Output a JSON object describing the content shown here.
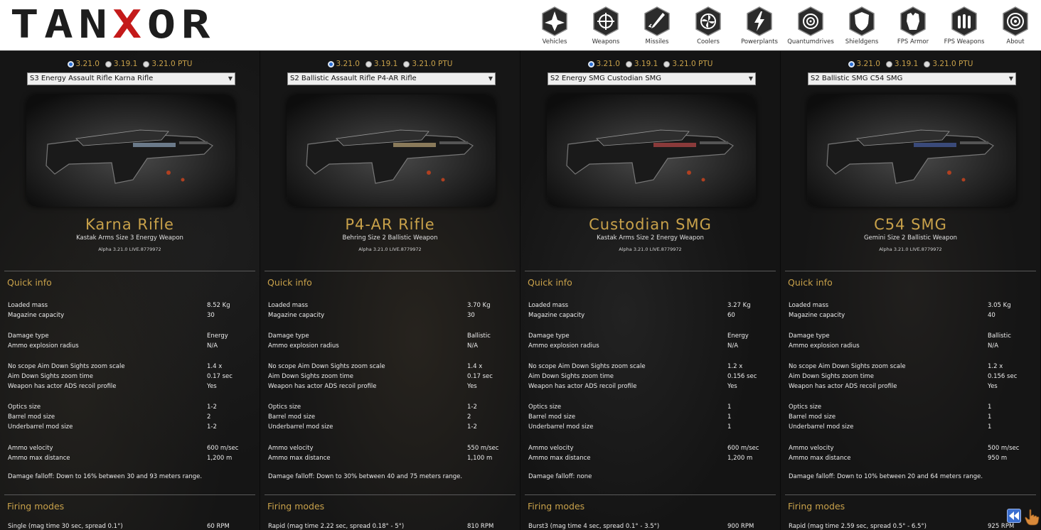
{
  "app": {
    "logo_text_a": "TAN",
    "logo_text_x": "X",
    "logo_text_b": "OR"
  },
  "nav": [
    {
      "label": "Vehicles",
      "icon": "vehicles-icon"
    },
    {
      "label": "Weapons",
      "icon": "crosshair-icon"
    },
    {
      "label": "Missiles",
      "icon": "missile-icon"
    },
    {
      "label": "Coolers",
      "icon": "fan-icon"
    },
    {
      "label": "Powerplants",
      "icon": "lightning-icon"
    },
    {
      "label": "Quantumdrives",
      "icon": "quantum-icon"
    },
    {
      "label": "Shieldgens",
      "icon": "shield-icon"
    },
    {
      "label": "FPS Armor",
      "icon": "armor-icon"
    },
    {
      "label": "FPS Weapons",
      "icon": "ammo-icon"
    },
    {
      "label": "About",
      "icon": "target-icon"
    }
  ],
  "columns": [
    {
      "versions": [
        "3.21.0",
        "3.19.1",
        "3.21.0 PTU"
      ],
      "selected_version": 0,
      "select_value": "S3 Energy Assault Rifle Karna Rifle",
      "name": "Karna Rifle",
      "subtitle": "Kastak Arms Size 3 Energy Weapon",
      "version_line": "Alpha 3.21.0 LIVE.8779972",
      "quick_info_title": "Quick info",
      "loaded_mass": "8.52 Kg",
      "magazine_capacity": "30",
      "damage_type": "Energy",
      "ammo_explosion_radius": "N/A",
      "no_scope_zoom": "1.4 x",
      "ads_zoom_time": "0.17 sec",
      "ads_recoil": "Yes",
      "optics_size": "1-2",
      "barrel_mod_size": "2",
      "underbarrel_mod_size": "1-2",
      "ammo_velocity": "600 m/sec",
      "ammo_max_distance": "1,200 m",
      "damage_falloff": "Damage falloff: Down to 16% between 30 and 93 meters range.",
      "firing_modes_title": "Firing modes",
      "firing_mode": "Single (mag time 30 sec, spread 0.1°)",
      "firing_rpm": "60 RPM",
      "accent": "#6b7a8a"
    },
    {
      "versions": [
        "3.21.0",
        "3.19.1",
        "3.21.0 PTU"
      ],
      "selected_version": 0,
      "select_value": "S2 Ballistic Assault Rifle P4-AR Rifle",
      "name": "P4-AR Rifle",
      "subtitle": "Behring Size 2 Ballistic Weapon",
      "version_line": "Alpha 3.21.0 LIVE.8779972",
      "quick_info_title": "Quick info",
      "loaded_mass": "3.70 Kg",
      "magazine_capacity": "30",
      "damage_type": "Ballistic",
      "ammo_explosion_radius": "N/A",
      "no_scope_zoom": "1.4 x",
      "ads_zoom_time": "0.17 sec",
      "ads_recoil": "Yes",
      "optics_size": "1-2",
      "barrel_mod_size": "2",
      "underbarrel_mod_size": "1-2",
      "ammo_velocity": "550 m/sec",
      "ammo_max_distance": "1,100 m",
      "damage_falloff": "Damage falloff: Down to 30% between 40 and 75 meters range.",
      "firing_modes_title": "Firing modes",
      "firing_mode": "Rapid (mag time 2.22 sec, spread 0.18° - 5°)",
      "firing_rpm": "810 RPM",
      "accent": "#8a7a5a"
    },
    {
      "versions": [
        "3.21.0",
        "3.19.1",
        "3.21.0 PTU"
      ],
      "selected_version": 0,
      "select_value": "S2 Energy SMG Custodian SMG",
      "name": "Custodian SMG",
      "subtitle": "Kastak Arms Size 2 Energy Weapon",
      "version_line": "Alpha 3.21.0 LIVE.8779972",
      "quick_info_title": "Quick info",
      "loaded_mass": "3.27 Kg",
      "magazine_capacity": "60",
      "damage_type": "Energy",
      "ammo_explosion_radius": "N/A",
      "no_scope_zoom": "1.2 x",
      "ads_zoom_time": "0.156 sec",
      "ads_recoil": "Yes",
      "optics_size": "1",
      "barrel_mod_size": "1",
      "underbarrel_mod_size": "1",
      "ammo_velocity": "600 m/sec",
      "ammo_max_distance": "1,200 m",
      "damage_falloff": "Damage falloff: none",
      "firing_modes_title": "Firing modes",
      "firing_mode": "Burst3 (mag time 4 sec, spread 0.1° - 3.5°)",
      "firing_rpm": "900 RPM",
      "accent": "#8a3a3a"
    },
    {
      "versions": [
        "3.21.0",
        "3.19.1",
        "3.21.0 PTU"
      ],
      "selected_version": 0,
      "select_value": "S2 Ballistic SMG C54 SMG",
      "name": "C54 SMG",
      "subtitle": "Gemini Size 2 Ballistic Weapon",
      "version_line": "Alpha 3.21.0 LIVE.8779972",
      "quick_info_title": "Quick info",
      "loaded_mass": "3.05 Kg",
      "magazine_capacity": "40",
      "damage_type": "Ballistic",
      "ammo_explosion_radius": "N/A",
      "no_scope_zoom": "1.2 x",
      "ads_zoom_time": "0.156 sec",
      "ads_recoil": "Yes",
      "optics_size": "1",
      "barrel_mod_size": "1",
      "underbarrel_mod_size": "1",
      "ammo_velocity": "500 m/sec",
      "ammo_max_distance": "950 m",
      "damage_falloff": "Damage falloff: Down to 10% between 20 and 64 meters range.",
      "firing_modes_title": "Firing modes",
      "firing_mode": "Rapid (mag time 2.59 sec, spread 0.5° - 6.5°)",
      "firing_rpm": "925 RPM",
      "accent": "#3a4a7a"
    }
  ],
  "labels": {
    "loaded_mass": "Loaded mass",
    "magazine_capacity": "Magazine capacity",
    "damage_type": "Damage type",
    "ammo_explosion_radius": "Ammo explosion radius",
    "no_scope_zoom": "No scope Aim Down Sights zoom scale",
    "ads_zoom_time": "Aim Down Sights zoom time",
    "ads_recoil": "Weapon has actor ADS recoil profile",
    "optics_size": "Optics size",
    "barrel_mod_size": "Barrel mod size",
    "underbarrel_mod_size": "Underbarrel mod size",
    "ammo_velocity": "Ammo velocity",
    "ammo_max_distance": "Ammo max distance"
  }
}
